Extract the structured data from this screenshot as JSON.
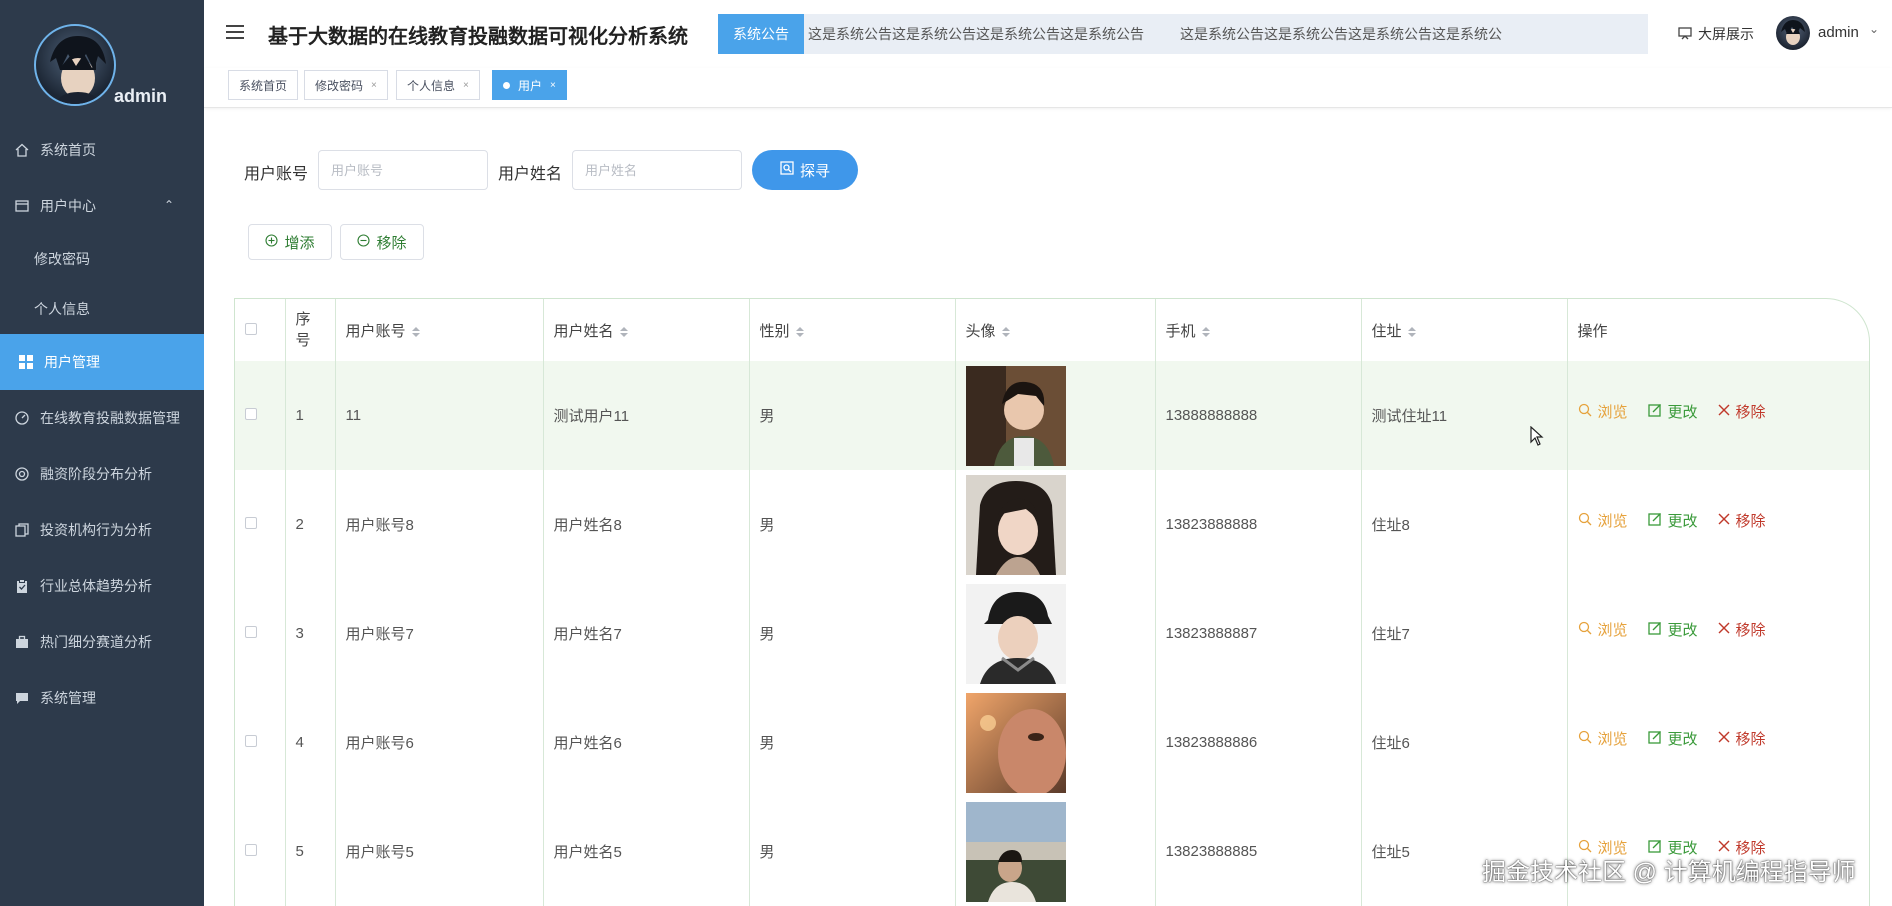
{
  "sidebar": {
    "username": "admin",
    "items": [
      {
        "label": "系统首页",
        "icon": "home-icon"
      },
      {
        "label": "用户中心",
        "icon": "user-center-icon"
      },
      {
        "label": "修改密码"
      },
      {
        "label": "个人信息"
      },
      {
        "label": "用户管理",
        "icon": "grid-icon"
      },
      {
        "label": "在线教育投融数据管理",
        "icon": "dashboard-icon"
      },
      {
        "label": "融资阶段分布分析",
        "icon": "lifebuoy-icon"
      },
      {
        "label": "投资机构行为分析",
        "icon": "copy-icon"
      },
      {
        "label": "行业总体趋势分析",
        "icon": "clipboard-icon"
      },
      {
        "label": "热门细分赛道分析",
        "icon": "briefcase-icon"
      },
      {
        "label": "系统管理",
        "icon": "chat-icon"
      }
    ]
  },
  "header": {
    "title": "基于大数据的在线教育投融数据可视化分析系统",
    "notice_label": "系统公告",
    "notice_text": "这是系统公告这是系统公告这是系统公告这是系统公告",
    "notice_text2": "这是系统公告这是系统公告这是系统公告这是系统公",
    "big_screen": "大屏展示",
    "user": "admin"
  },
  "tabs": [
    {
      "label": "系统首页"
    },
    {
      "label": "修改密码",
      "close": "×"
    },
    {
      "label": "个人信息",
      "close": "×"
    },
    {
      "label": "用户",
      "close": "×"
    }
  ],
  "search": {
    "account_label": "用户账号",
    "account_placeholder": "用户账号",
    "name_label": "用户姓名",
    "name_placeholder": "用户姓名",
    "button": "探寻"
  },
  "actions": {
    "add": "增添",
    "remove": "移除"
  },
  "table": {
    "headers": {
      "index": "序号",
      "account": "用户账号",
      "name": "用户姓名",
      "gender": "性别",
      "avatar": "头像",
      "phone": "手机",
      "address": "住址",
      "ops": "操作"
    },
    "op_labels": {
      "view": "浏览",
      "edit": "更改",
      "delete": "移除"
    },
    "rows": [
      {
        "index": "1",
        "account": "11",
        "name": "测试用户11",
        "gender": "男",
        "phone": "13888888888",
        "address": "测试住址11"
      },
      {
        "index": "2",
        "account": "用户账号8",
        "name": "用户姓名8",
        "gender": "男",
        "phone": "13823888888",
        "address": "住址8"
      },
      {
        "index": "3",
        "account": "用户账号7",
        "name": "用户姓名7",
        "gender": "男",
        "phone": "13823888887",
        "address": "住址7"
      },
      {
        "index": "4",
        "account": "用户账号6",
        "name": "用户姓名6",
        "gender": "男",
        "phone": "13823888886",
        "address": "住址6"
      },
      {
        "index": "5",
        "account": "用户账号5",
        "name": "用户姓名5",
        "gender": "男",
        "phone": "13823888885",
        "address": "住址5"
      }
    ]
  },
  "watermark": "掘金技术社区 @ 计算机编程指导师",
  "colors": {
    "sidebar_bg": "#2d3a4b",
    "accent": "#4aa3ea",
    "highlight_row": "#f1f8ef",
    "view": "#e6a23c",
    "edit": "#3a9a3a",
    "delete": "#c0392b"
  }
}
